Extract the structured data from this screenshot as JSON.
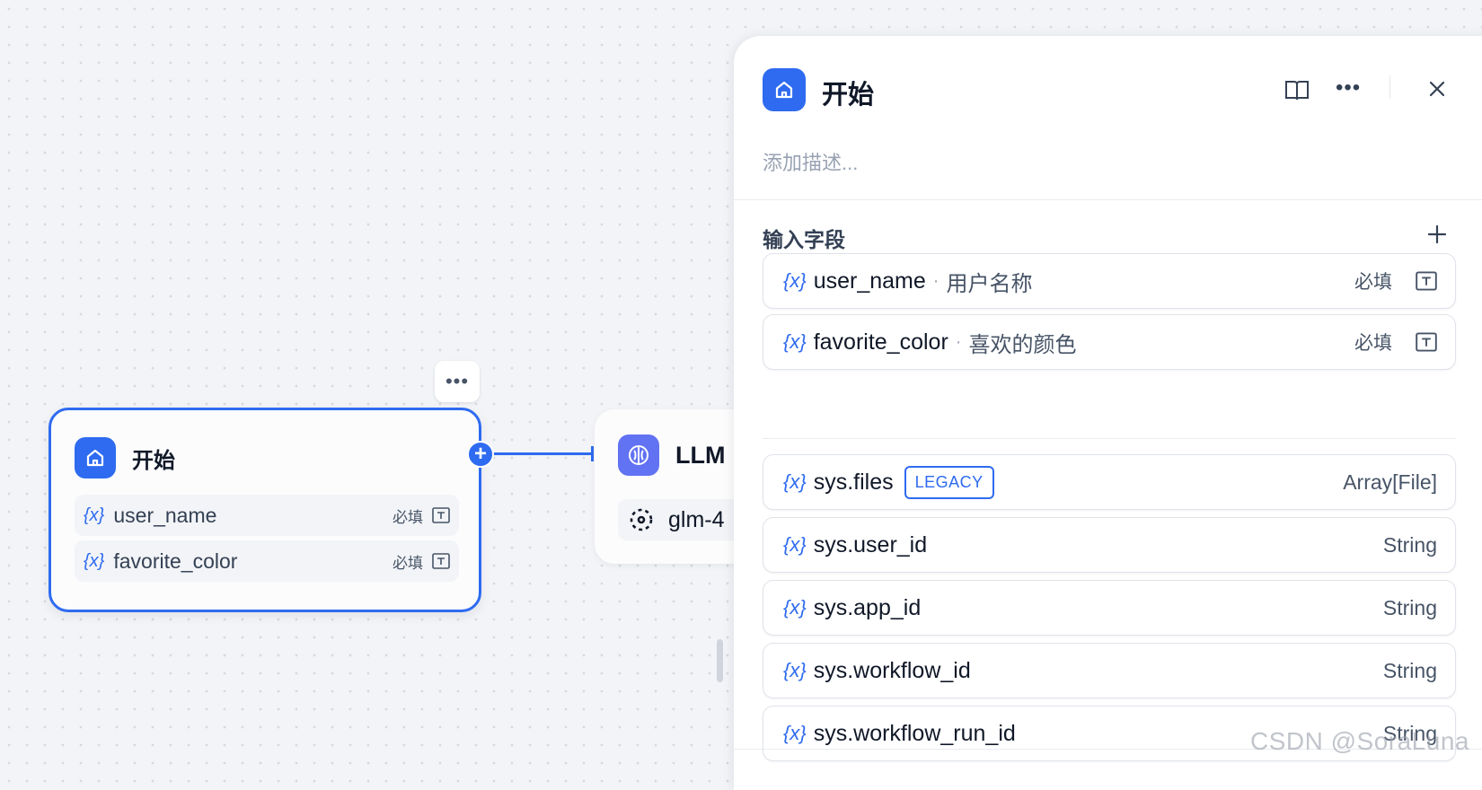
{
  "canvas": {
    "start_node": {
      "title": "开始",
      "fields": [
        {
          "var": "{x}",
          "name": "user_name",
          "required": "必填"
        },
        {
          "var": "{x}",
          "name": "favorite_color",
          "required": "必填"
        }
      ],
      "more_label": "•••"
    },
    "llm_node": {
      "title": "LLM",
      "model": "glm-4"
    },
    "colors": {
      "accent": "#2e6bf0",
      "llm": "#6172f3"
    }
  },
  "panel": {
    "title": "开始",
    "more_label": "•••",
    "description_placeholder": "添加描述...",
    "section_title": "输入字段",
    "input_fields": [
      {
        "var": "{x}",
        "name": "user_name",
        "label": "用户名称",
        "required": "必填"
      },
      {
        "var": "{x}",
        "name": "favorite_color",
        "label": "喜欢的颜色",
        "required": "必填"
      }
    ],
    "system_vars": [
      {
        "var": "{x}",
        "name": "sys.files",
        "badge": "LEGACY",
        "type": "Array[File]"
      },
      {
        "var": "{x}",
        "name": "sys.user_id",
        "type": "String"
      },
      {
        "var": "{x}",
        "name": "sys.app_id",
        "type": "String"
      },
      {
        "var": "{x}",
        "name": "sys.workflow_id",
        "type": "String"
      },
      {
        "var": "{x}",
        "name": "sys.workflow_run_id",
        "type": "String"
      }
    ]
  },
  "watermark": "CSDN @SoraLuna"
}
